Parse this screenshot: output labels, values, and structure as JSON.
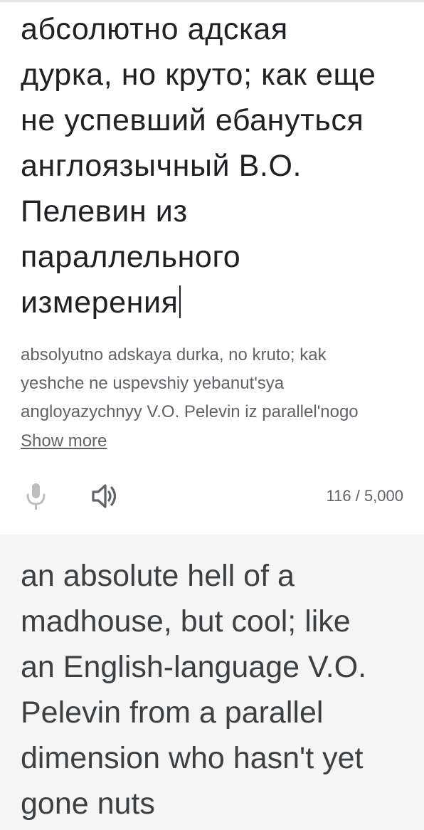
{
  "source": {
    "text": "абсолютно адская\nдурка, но круто; как еще\nне успевший ебануться\nанглоязычный В.О.\nПелевин из\nпараллельного\nизмерения",
    "transliteration": "absolyutno adskaya durka, no kruto; kak\nyeshche ne uspevshiy yebanut'sya\nangloyazychnyy V.O. Pelevin iz parallel'nogo",
    "show_more_label": "Show more"
  },
  "toolbar": {
    "mic_icon": "microphone-icon",
    "speaker_icon": "speaker-icon",
    "char_count": "116 / 5,000"
  },
  "target": {
    "text": "an absolute hell of a\nmadhouse, but cool; like\nan English-language V.O.\nPelevin from a parallel\ndimension who hasn't yet\ngone nuts"
  },
  "colors": {
    "source_text": "#202124",
    "secondary_text": "#5f6368",
    "mic_disabled": "#bdbdbd",
    "speaker": "#5f6368",
    "target_background": "#f5f5f5",
    "target_text": "#3c4043"
  }
}
